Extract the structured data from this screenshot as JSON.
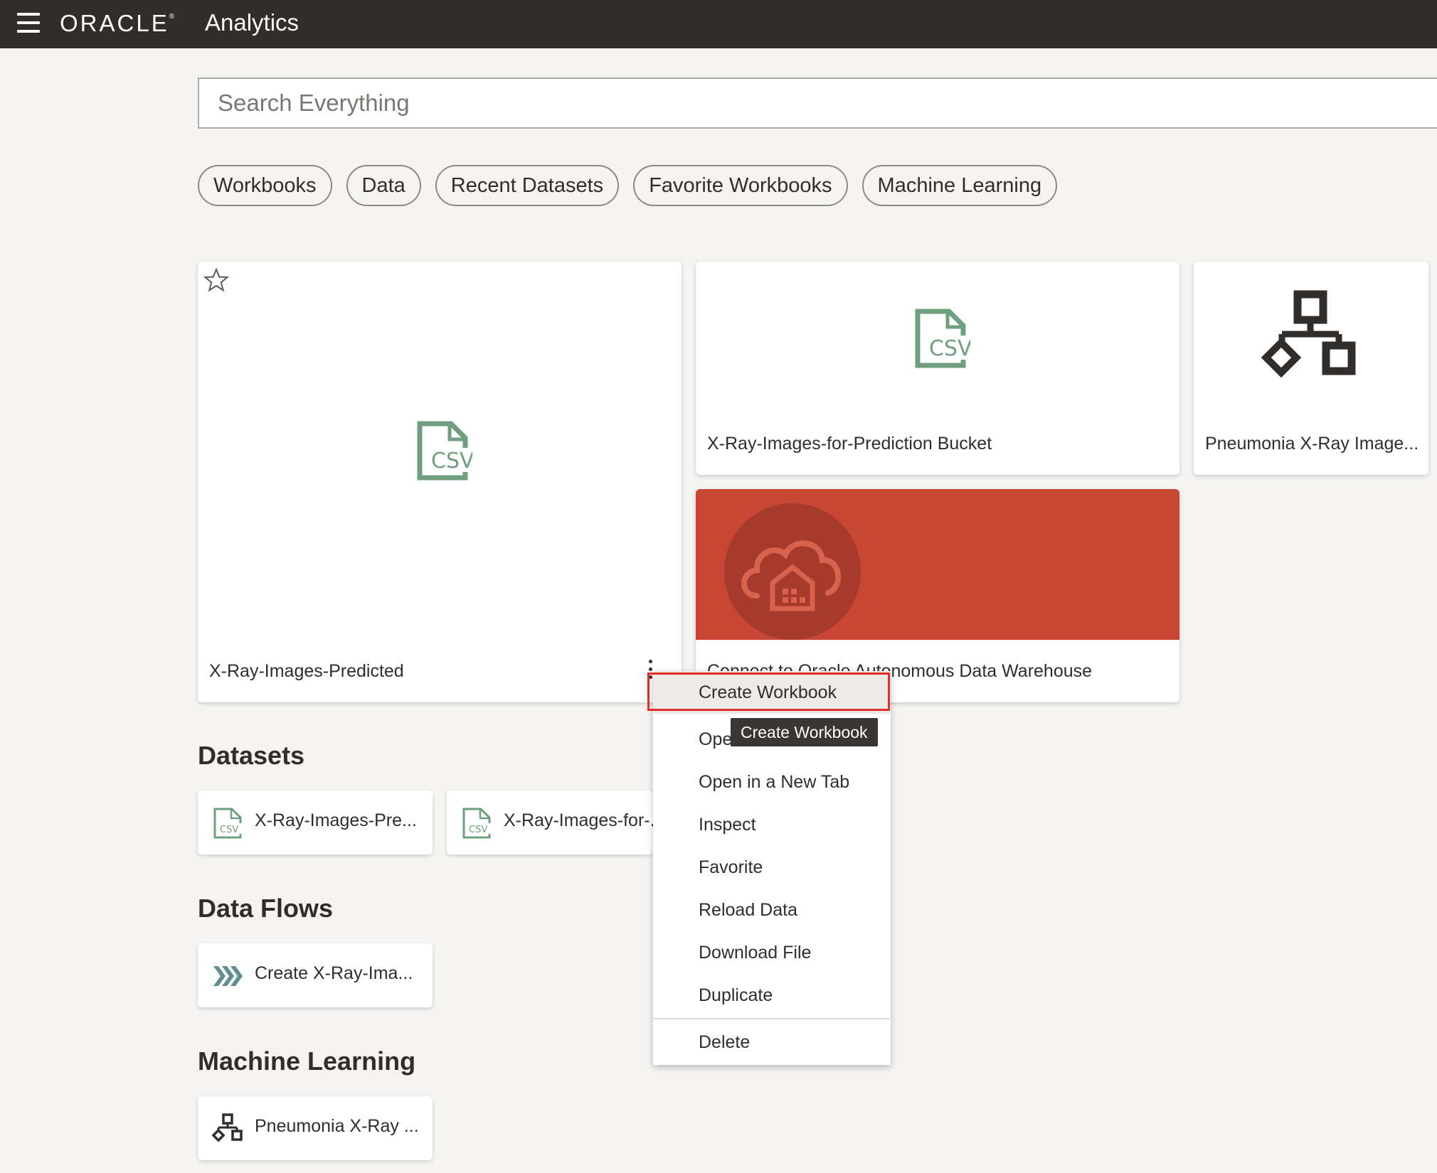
{
  "header": {
    "brand": "ORACLE",
    "trademark": "®",
    "product": "Analytics"
  },
  "search": {
    "placeholder": "Search Everything",
    "value": ""
  },
  "filters": [
    "Workbooks",
    "Data",
    "Recent Datasets",
    "Favorite Workbooks",
    "Machine Learning"
  ],
  "cards": {
    "predicted": {
      "title": "X-Ray-Images-Predicted",
      "icon": "csv-file-icon"
    },
    "bucket": {
      "title": "X-Ray-Images-for-Prediction Bucket",
      "icon": "csv-file-icon"
    },
    "pneumonia": {
      "title": "Pneumonia X-Ray Image...",
      "icon": "ml-model-icon"
    },
    "connect": {
      "title": "Connect to Oracle Autonomous Data Warehouse",
      "icon": "cloud-warehouse-icon",
      "banner_color": "#c74634"
    }
  },
  "sections": {
    "datasets": {
      "heading": "Datasets",
      "items": [
        "X-Ray-Images-Pre...",
        "X-Ray-Images-for-..."
      ]
    },
    "data_flows": {
      "heading": "Data Flows",
      "items": [
        "Create X-Ray-Ima..."
      ]
    },
    "machine_learning": {
      "heading": "Machine Learning",
      "items": [
        "Pneumonia X-Ray ..."
      ]
    }
  },
  "context_menu": {
    "items": [
      "Create Workbook",
      "Open",
      "Open in a New Tab",
      "Inspect",
      "Favorite",
      "Reload Data",
      "Download File",
      "Duplicate",
      "Delete"
    ],
    "highlighted": "Create Workbook"
  },
  "tooltip": "Create Workbook",
  "colors": {
    "topbar": "#312d2a",
    "csv_green": "#6f9f7e",
    "oracle_red": "#c74634",
    "highlight_border": "#e22d25"
  }
}
